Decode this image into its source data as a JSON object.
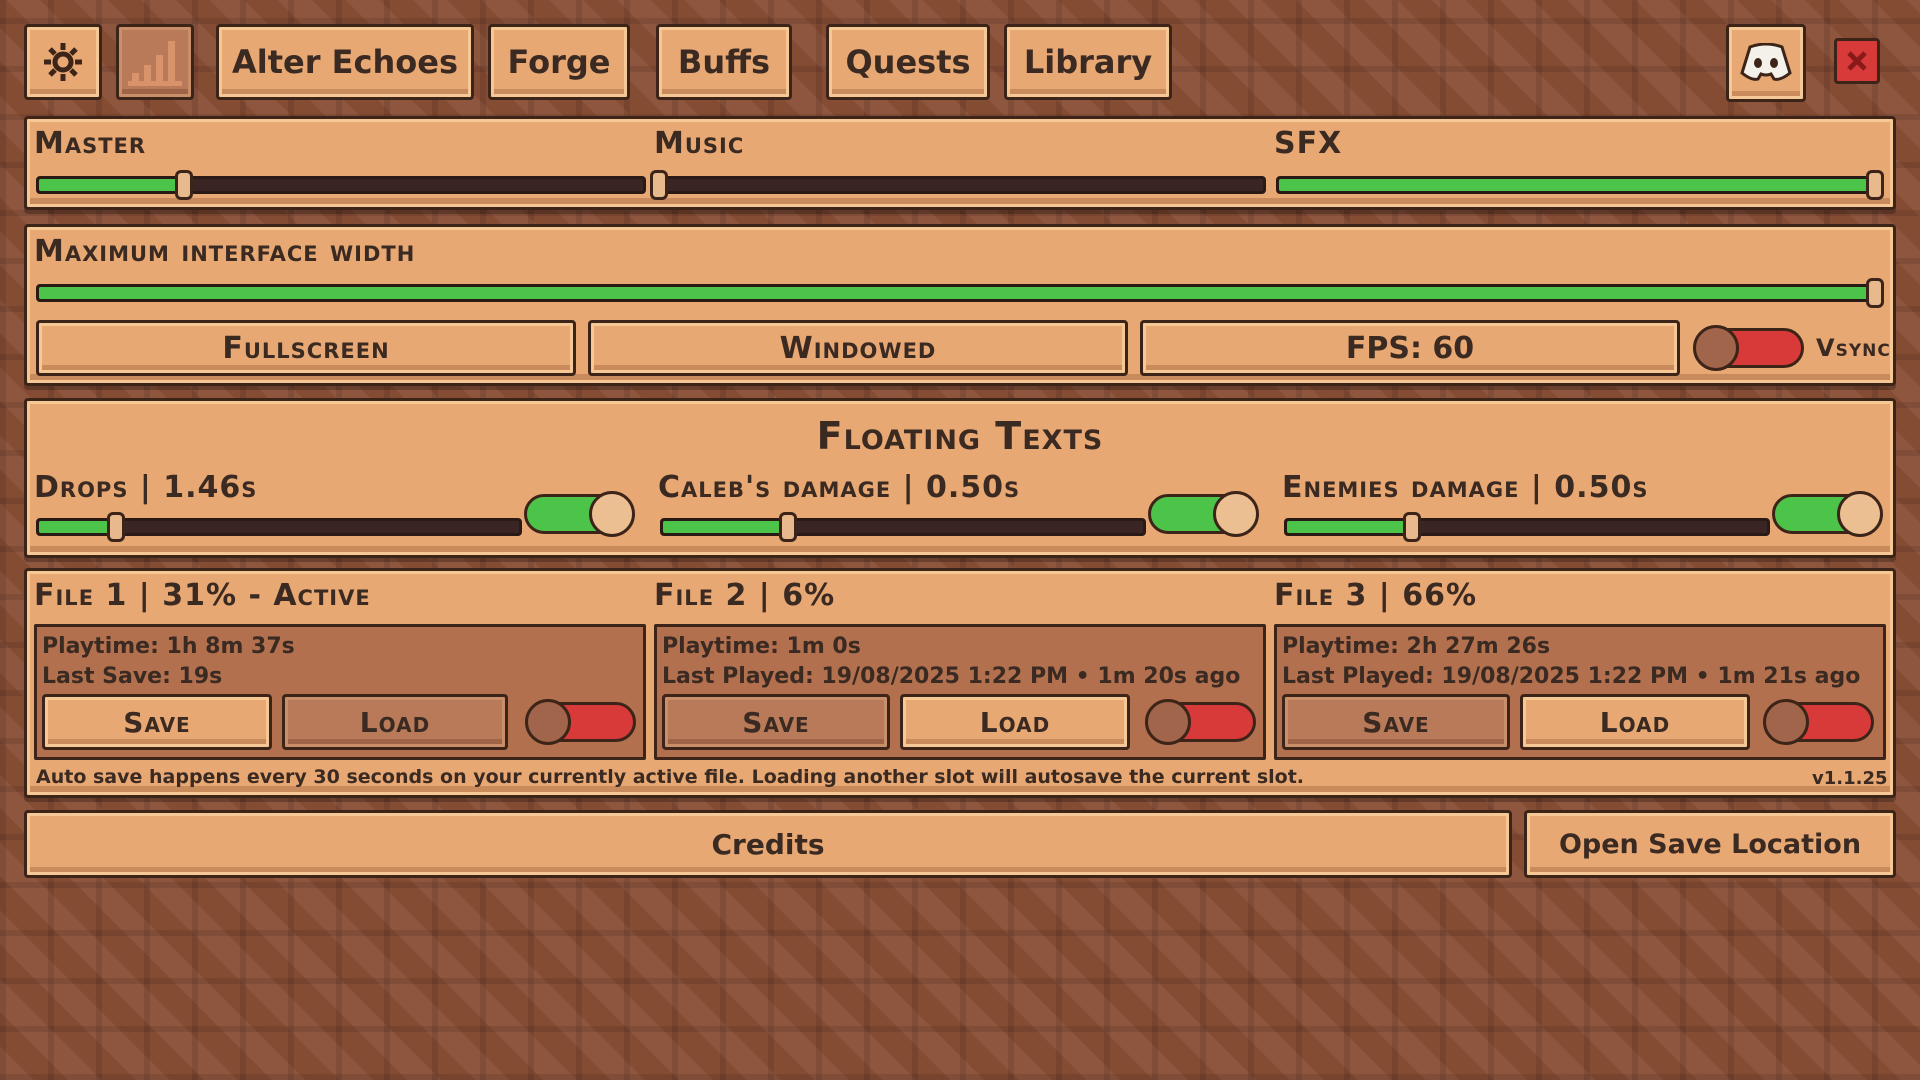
{
  "nav": {
    "tabs": [
      "Alter Echoes",
      "Forge",
      "Buffs",
      "Quests",
      "Library"
    ],
    "icons": [
      "gear-icon",
      "stats-bars-icon",
      "discord-icon",
      "close-icon"
    ]
  },
  "audio": {
    "master_label": "Master",
    "master_value": 0.24,
    "music_label": "Music",
    "music_value": 0.0,
    "sfx_label": "SFX",
    "sfx_value": 1.0
  },
  "display": {
    "width_label": "Maximum interface width",
    "width_value": 1.0,
    "fullscreen_label": "Fullscreen",
    "windowed_label": "Windowed",
    "fps_label": "FPS: 60",
    "vsync_label": "Vsync",
    "vsync_on": false
  },
  "floating": {
    "title": "Floating Texts",
    "drops_label": "Drops | 1.46s",
    "drops_value": 0.16,
    "drops_on": true,
    "caleb_label": "Caleb's damage | 0.50s",
    "caleb_value": 0.26,
    "caleb_on": true,
    "enemies_label": "Enemies damage | 0.50s",
    "enemies_value": 0.26,
    "enemies_on": true
  },
  "files": [
    {
      "title": "File 1 | 31% - Active",
      "line1": "Playtime: 1h 8m 37s",
      "line2": "Last Save: 19s",
      "save": "Save",
      "load": "Load",
      "toggle_on": false
    },
    {
      "title": "File 2 | 6%",
      "line1": "Playtime: 1m 0s",
      "line2": "Last Played: 19/08/2025 1:22 PM • 1m 20s  ago",
      "save": "Save",
      "load": "Load",
      "toggle_on": false
    },
    {
      "title": "File 3 | 66%",
      "line1": "Playtime: 2h 27m 26s",
      "line2": "Last Played: 19/08/2025 1:22 PM • 1m 21s  ago",
      "save": "Save",
      "load": "Load",
      "toggle_on": false
    }
  ],
  "footer": {
    "autosave_note": "Auto save happens every 30 seconds on your currently active file. Loading another slot will autosave the current slot.",
    "version": "v1.1.25",
    "credits": "Credits",
    "open_save": "Open Save Location"
  },
  "colors": {
    "accent_green": "#4cc44a",
    "toggle_red": "#d83a3a",
    "panel": "#e8a874",
    "outline": "#3c2418"
  }
}
